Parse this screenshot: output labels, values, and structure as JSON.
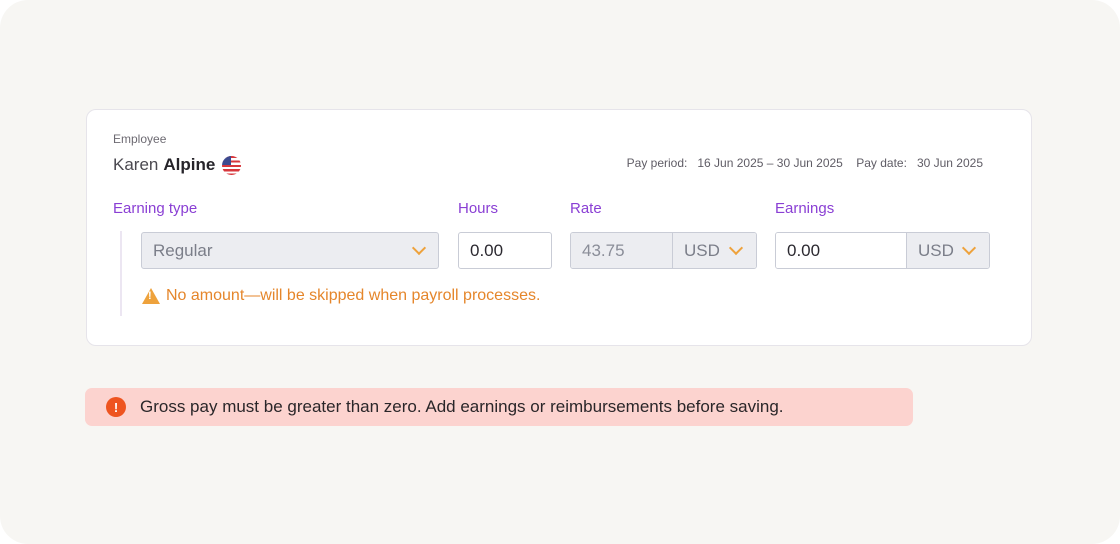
{
  "employee": {
    "label": "Employee",
    "first_name": "Karen",
    "last_name": "Alpine",
    "flag_icon": "us-flag-icon"
  },
  "pay": {
    "period_label": "Pay period:",
    "period_value": "16 Jun 2025 – 30 Jun 2025",
    "date_label": "Pay date:",
    "date_value": "30 Jun 2025"
  },
  "columns": {
    "earning_type": "Earning type",
    "hours": "Hours",
    "rate": "Rate",
    "earnings": "Earnings"
  },
  "row": {
    "earning_type_value": "Regular",
    "hours_value": "0.00",
    "rate_value": "43.75",
    "rate_currency": "USD",
    "earnings_value": "0.00",
    "earnings_currency": "USD",
    "warning": "No amount—will be skipped when payroll processes."
  },
  "error": {
    "message": "Gross pay must be greater than zero. Add earnings or reimbursements before saving."
  },
  "colors": {
    "accent_purple": "#8a3fd4",
    "warning_orange": "#e5862b",
    "error_bg": "#fcd3cf",
    "error_icon": "#ee5420"
  }
}
